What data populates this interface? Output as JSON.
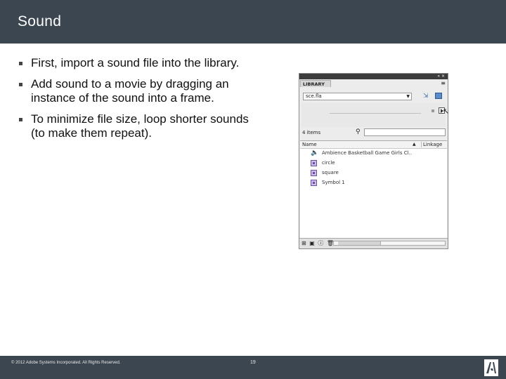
{
  "slide": {
    "title": "Sound",
    "bullets": [
      "First, import a sound file into the library.",
      "Add sound to a movie by dragging an instance of the sound into a frame.",
      "To minimize file size, loop shorter sounds (to make them repeat)."
    ]
  },
  "library_panel": {
    "tab_label": "LIBRARY",
    "top_controls": "« ×",
    "menu_icon": "≡",
    "document": "sce.fla",
    "item_count_label": "4 items",
    "column_name": "Name",
    "column_linkage": "Linkage",
    "sort_glyph": "▲",
    "items": [
      {
        "label": "Ambience Basketball Game Girls Cl..",
        "icon": "sound-icon"
      },
      {
        "label": "circle",
        "icon": "movieclip-icon"
      },
      {
        "label": "square",
        "icon": "movieclip-icon"
      },
      {
        "label": "Symbol 1",
        "icon": "movieclip-icon"
      }
    ]
  },
  "footer": {
    "copyright": "© 2012 Adobe Systems Incorporated. All Rights Reserved.",
    "page_number": "19"
  },
  "colors": {
    "header_bg": "#3b4650",
    "footer_bg": "#3b4650"
  }
}
